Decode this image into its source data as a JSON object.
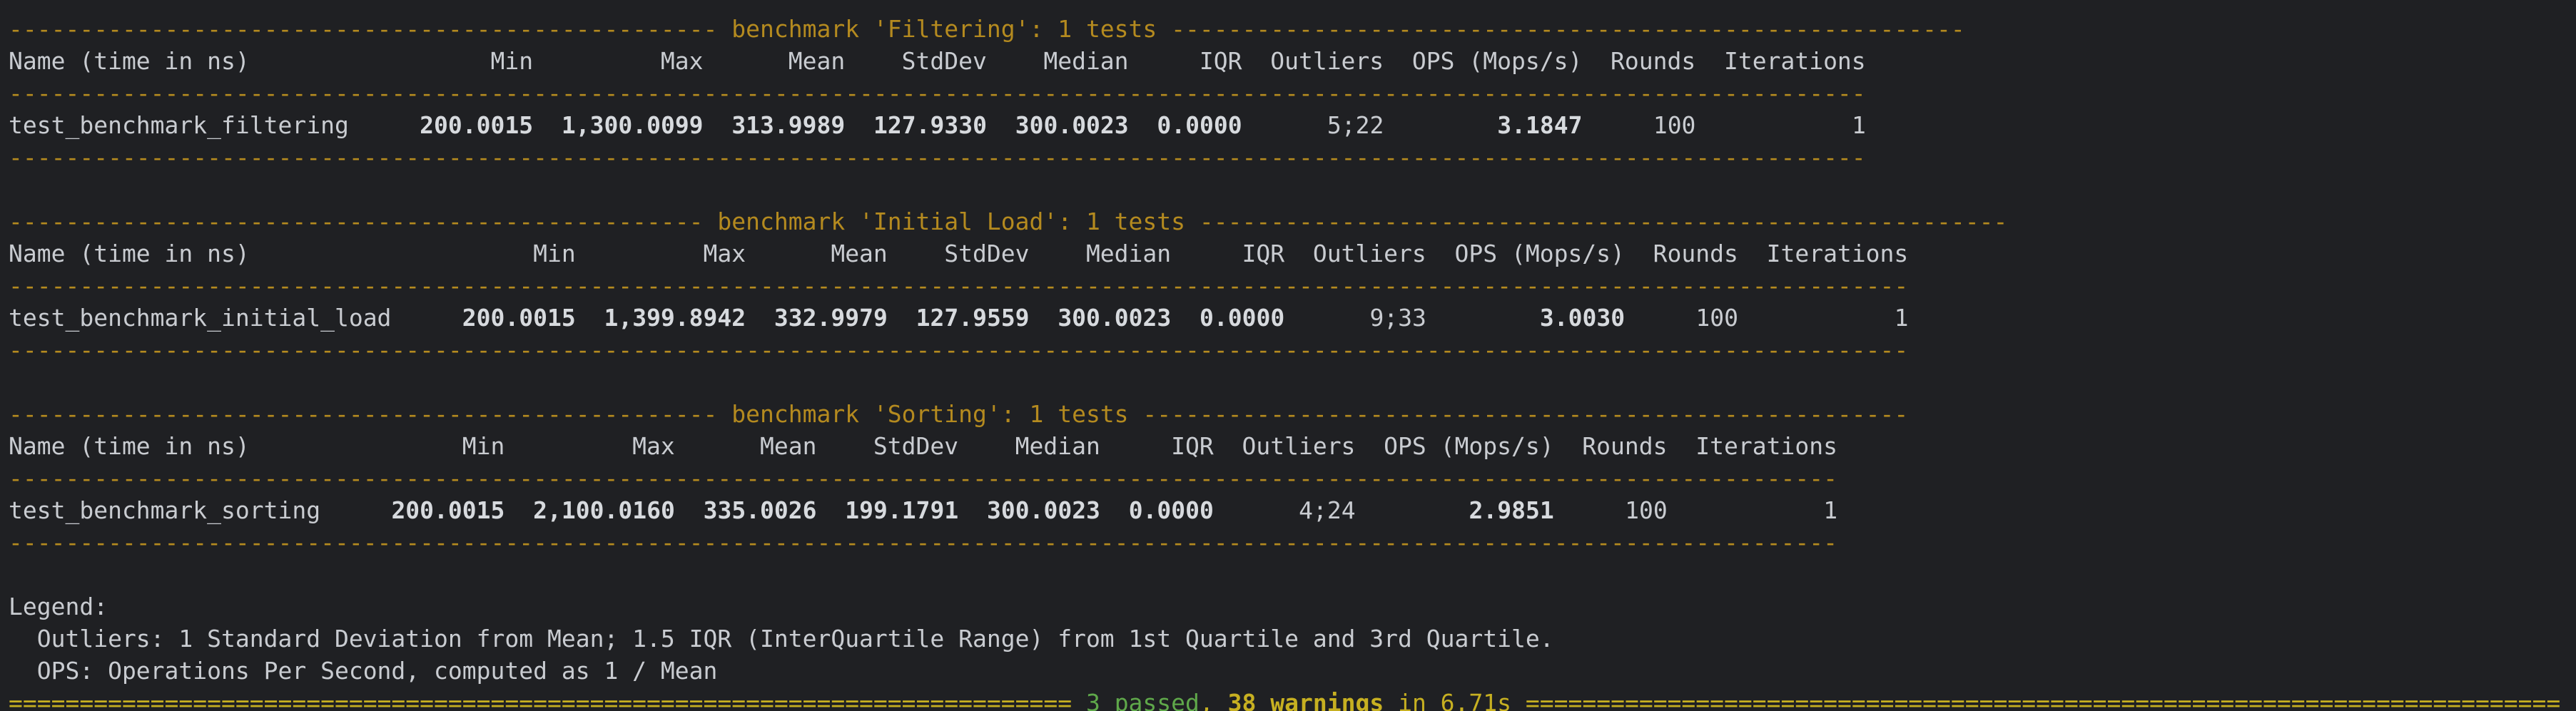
{
  "benchmarks": [
    {
      "title_line": "-------------------------------------------------- benchmark 'Filtering': 1 tests --------------------------------------------------------",
      "header": "Name (time in ns)                 Min         Max      Mean    StdDev    Median     IQR  Outliers  OPS (Mops/s)  Rounds  Iterations",
      "sep": "-----------------------------------------------------------------------------------------------------------------------------------",
      "row": {
        "name": "test_benchmark_filtering     ",
        "min": "200.0015",
        "gap1": "  ",
        "max": "1,300.0099",
        "gap2": "  ",
        "mean": "313.9989",
        "gap3": "  ",
        "stddev": "127.9330",
        "gap4": "  ",
        "median": "300.0023",
        "gap5": "  ",
        "iqr": "0.0000",
        "mid": "      5;22        ",
        "ops": "3.1847",
        "tail": "     100           1"
      }
    },
    {
      "title_line": "------------------------------------------------- benchmark 'Initial Load': 1 tests ---------------------------------------------------------",
      "header": "Name (time in ns)                    Min         Max      Mean    StdDev    Median     IQR  Outliers  OPS (Mops/s)  Rounds  Iterations",
      "sep": "--------------------------------------------------------------------------------------------------------------------------------------",
      "row": {
        "name": "test_benchmark_initial_load     ",
        "min": "200.0015",
        "gap1": "  ",
        "max": "1,399.8942",
        "gap2": "  ",
        "mean": "332.9979",
        "gap3": "  ",
        "stddev": "127.9559",
        "gap4": "  ",
        "median": "300.0023",
        "gap5": "  ",
        "iqr": "0.0000",
        "mid": "      9;33        ",
        "ops": "3.0030",
        "tail": "     100           1"
      }
    },
    {
      "title_line": "-------------------------------------------------- benchmark 'Sorting': 1 tests ------------------------------------------------------",
      "header": "Name (time in ns)               Min         Max      Mean    StdDev    Median     IQR  Outliers  OPS (Mops/s)  Rounds  Iterations",
      "sep": "---------------------------------------------------------------------------------------------------------------------------------",
      "row": {
        "name": "test_benchmark_sorting     ",
        "min": "200.0015",
        "gap1": "  ",
        "max": "2,100.0160",
        "gap2": "  ",
        "mean": "335.0026",
        "gap3": "  ",
        "stddev": "199.1791",
        "gap4": "  ",
        "median": "300.0023",
        "gap5": "  ",
        "iqr": "0.0000",
        "mid": "      4;24        ",
        "ops": "2.9851",
        "tail": "     100           1"
      }
    }
  ],
  "legend": {
    "title": "Legend:",
    "outliers": "  Outliers: 1 Standard Deviation from Mean; 1.5 IQR (InterQuartile Range) from 1st Quartile and 3rd Quartile.",
    "ops": "  OPS: Operations Per Second, computed as 1 / Mean"
  },
  "summary": {
    "left_rule": "=========================================================================== ",
    "passed": "3 passed",
    "comma": ", ",
    "warnings": "38 warnings",
    "in_text": " in 6.71s",
    "right_rule": " ========================================================================="
  }
}
